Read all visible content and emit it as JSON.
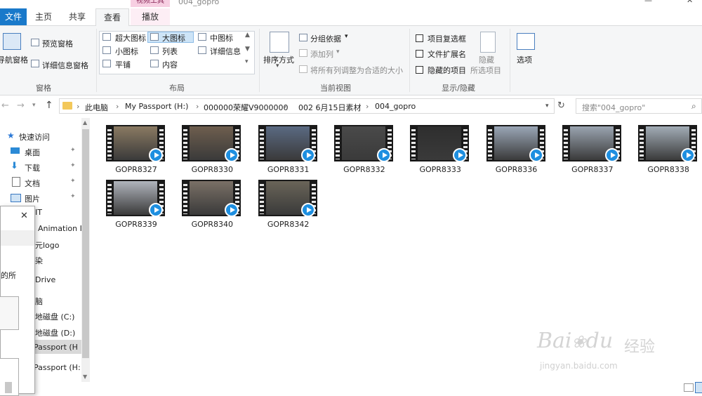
{
  "window": {
    "title": "004_gopro",
    "context_tab": "视频工具"
  },
  "tabs": [
    {
      "label": "文件",
      "kind": "file"
    },
    {
      "label": "主页",
      "kind": "normal"
    },
    {
      "label": "共享",
      "kind": "normal"
    },
    {
      "label": "查看",
      "kind": "active"
    },
    {
      "label": "播放",
      "kind": "normal"
    }
  ],
  "ribbon": {
    "panes": {
      "nav_pane": "导航窗格",
      "preview_pane": "预览窗格",
      "details_pane": "详细信息窗格",
      "group_label": "窗格"
    },
    "layout": {
      "items": [
        "超大图标",
        "大图标",
        "中图标",
        "小图标",
        "列表",
        "详细信息",
        "平铺",
        "内容"
      ],
      "selected": "大图标",
      "group_label": "布局"
    },
    "current_view": {
      "sort_by": "排序方式",
      "group_by": "分组依据",
      "add_column": "添加列",
      "fit_columns": "将所有列调整为合适的大小",
      "group_label": "当前视图"
    },
    "show_hide": {
      "item_checkboxes": "项目复选框",
      "file_extensions": "文件扩展名",
      "hidden_items": "隐藏的项目",
      "hide_selected_1": "隐藏",
      "hide_selected_2": "所选项目",
      "group_label": "显示/隐藏"
    },
    "options": "选项"
  },
  "address": {
    "crumbs": [
      "此电脑",
      "My Passport (H:)",
      "000000荣耀V9000000",
      "002 6月15日素材",
      "004_gopro"
    ],
    "search_placeholder": "搜索\"004_gopro\""
  },
  "nav_pane": {
    "quick_access": "快速访问",
    "items": [
      "桌面",
      "下载",
      "文档",
      "图片"
    ],
    "partial_items": [
      "IT",
      "Animation I",
      "元logo",
      "染",
      "Drive",
      "脑",
      "地磁盘 (C:)",
      "地磁盘 (D:)",
      "Passport (H",
      "Passport (H:"
    ]
  },
  "dialog": {
    "close": "✕",
    "partial_text": "的所"
  },
  "files": [
    {
      "name": "GOPR8327",
      "scene": "#8a7a62"
    },
    {
      "name": "GOPR8330",
      "scene": "#6e5e4e"
    },
    {
      "name": "GOPR8331",
      "scene": "#5a6a82"
    },
    {
      "name": "GOPR8332",
      "scene": "#4a4a4a"
    },
    {
      "name": "GOPR8333",
      "scene": "#2e2e2e"
    },
    {
      "name": "GOPR8336",
      "scene": "#9aa6b6"
    },
    {
      "name": "GOPR8337",
      "scene": "#9aa4b0"
    },
    {
      "name": "GOPR8338",
      "scene": "#a2acb6"
    },
    {
      "name": "GOPR8339",
      "scene": "#b0b4bc"
    },
    {
      "name": "GOPR8340",
      "scene": "#7a7066"
    },
    {
      "name": "GOPR8342",
      "scene": "#6a6458"
    }
  ],
  "watermark": {
    "brand": "Bai",
    "brand2": "du",
    "cn": "经验",
    "url": "jingyan.baidu.com"
  }
}
